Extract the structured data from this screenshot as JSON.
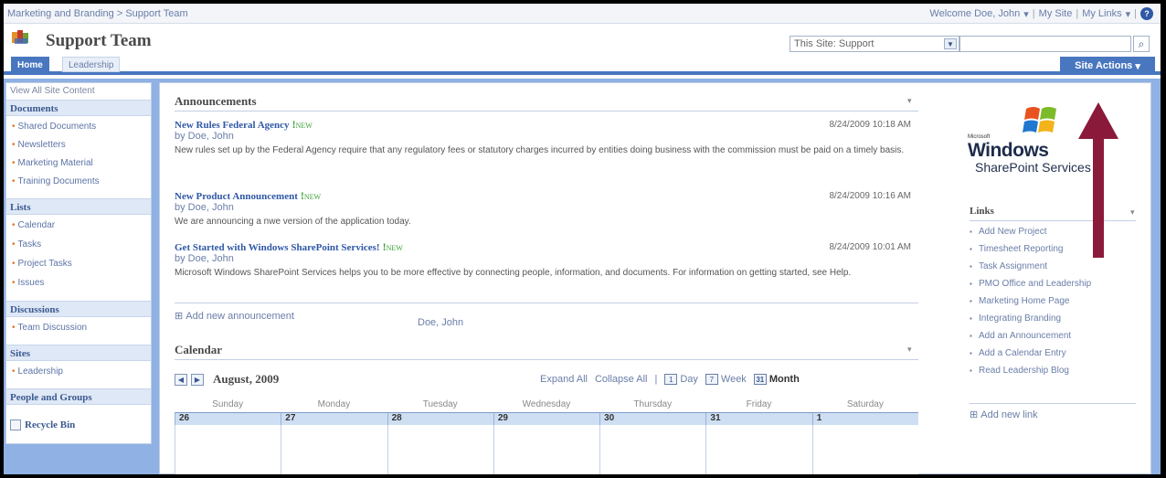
{
  "breadcrumb": "Marketing and Branding > Support Team",
  "top": {
    "welcome": "Welcome Doe, John",
    "my_site": "My Site",
    "my_links": "My Links"
  },
  "site": {
    "title": "Support Team"
  },
  "search": {
    "scope": "This Site: Support",
    "value": ""
  },
  "tabs": [
    {
      "label": "Home"
    },
    {
      "label": "Leadership"
    }
  ],
  "site_actions": "Site Actions",
  "left_nav": {
    "view_all": "View All Site Content",
    "sections": [
      {
        "heading": "Documents",
        "items": [
          "Shared Documents",
          "Newsletters",
          "Marketing Material",
          "Training Documents"
        ]
      },
      {
        "heading": "Lists",
        "items": [
          "Calendar",
          "Tasks",
          "Project Tasks",
          "Issues"
        ]
      },
      {
        "heading": "Discussions",
        "items": [
          "Team Discussion"
        ]
      },
      {
        "heading": "Sites",
        "items": [
          "Leadership"
        ]
      },
      {
        "heading": "People and Groups",
        "items": []
      }
    ],
    "recycle_bin": "Recycle Bin"
  },
  "announcements": {
    "title": "Announcements",
    "items": [
      {
        "title": "New Rules Federal Agency",
        "new": "NEW",
        "by": "by Doe, John",
        "date": "8/24/2009 10:18 AM",
        "body": "New rules set up by the Federal Agency require that any regulatory fees or statutory charges incurred by entities doing business with the commission must be paid on a timely basis."
      },
      {
        "title": "New Product Announcement",
        "new": "NEW",
        "by": "by Doe, John",
        "date": "8/24/2009 10:16 AM",
        "body": "We are announcing a nwe version of the application today."
      },
      {
        "title": "Get Started with Windows SharePoint Services!",
        "new": "NEW",
        "by": "by Doe, John",
        "date": "8/24/2009 10:01 AM",
        "body": "Microsoft Windows SharePoint Services helps you to be more effective by connecting people, information, and documents. For information on getting started, see Help."
      }
    ],
    "add_new": "Add new announcement",
    "user": "Doe, John"
  },
  "calendar": {
    "title": "Calendar",
    "month": "August, 2009",
    "expand_all": "Expand All",
    "collapse_all": "Collapse All",
    "views": [
      {
        "label": "Day",
        "icon_label": "1"
      },
      {
        "label": "Week",
        "icon_label": "7"
      },
      {
        "label": "Month",
        "icon_label": "31"
      }
    ],
    "day_names": [
      "Sunday",
      "Monday",
      "Tuesday",
      "Wednesday",
      "Thursday",
      "Friday",
      "Saturday"
    ],
    "dates": [
      "26",
      "27",
      "28",
      "29",
      "30",
      "31",
      "1"
    ]
  },
  "wss_logo": {
    "microsoft": "Microsoft",
    "windows": "Windows",
    "sharepoint": "SharePoint Services"
  },
  "links": {
    "title": "Links",
    "items": [
      "Add New Project",
      "Timesheet Reporting",
      "Task Assignment",
      "PMO Office and Leadership",
      "Marketing Home Page",
      "Integrating Branding",
      "Add an Announcement",
      "Add a Calendar Entry",
      "Read Leadership Blog"
    ],
    "add_new": "Add new link"
  },
  "colors": {
    "accent": "#4877c0",
    "arrow": "#8b1a3a"
  }
}
